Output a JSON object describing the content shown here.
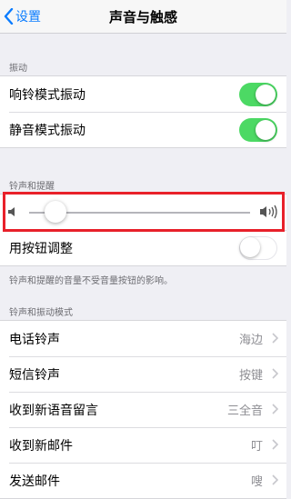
{
  "navbar": {
    "back_label": "设置",
    "title": "声音与触感"
  },
  "vibrate": {
    "header": "振动",
    "items": [
      {
        "label": "响铃模式振动",
        "on": true
      },
      {
        "label": "静音模式振动",
        "on": true
      }
    ]
  },
  "ringer": {
    "header": "铃声和提醒",
    "volume": 0.12,
    "change_with_buttons": {
      "label": "用按钮调整",
      "on": false
    },
    "footer": "铃声和提醒的音量不受音量按钮的影响。"
  },
  "patterns": {
    "header": "铃声和振动模式",
    "items": [
      {
        "label": "电话铃声",
        "value": "海边"
      },
      {
        "label": "短信铃声",
        "value": "按键"
      },
      {
        "label": "收到新语音留言",
        "value": "三全音"
      },
      {
        "label": "收到新邮件",
        "value": "叮"
      },
      {
        "label": "发送邮件",
        "value": "嗖"
      }
    ]
  },
  "colors": {
    "accent": "#0a7cff",
    "toggle_on": "#4cd964",
    "highlight": "#e8202a"
  },
  "icons": [
    "chevron-left-icon",
    "speaker-low-icon",
    "speaker-high-icon",
    "chevron-right-icon"
  ]
}
